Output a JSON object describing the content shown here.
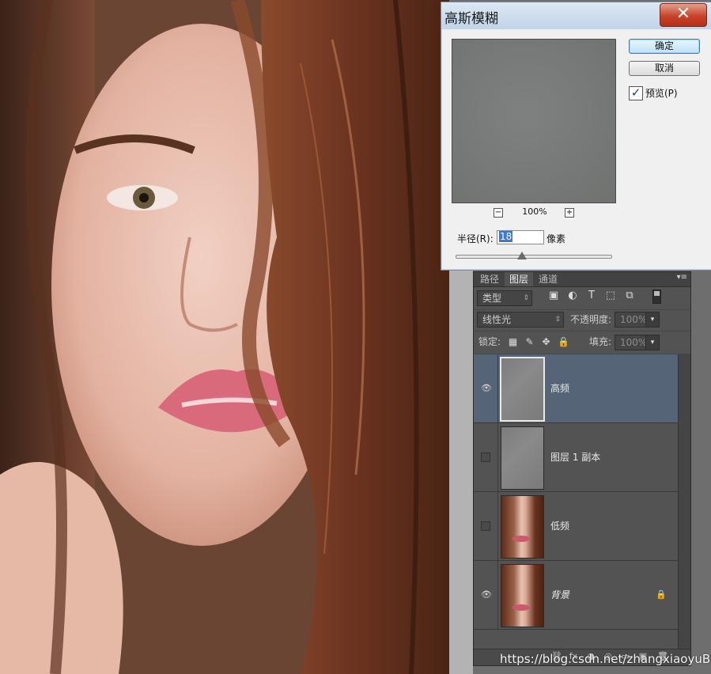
{
  "dialog": {
    "title": "高斯模糊",
    "close_glyph": "✕",
    "ok_label": "确定",
    "cancel_label": "取消",
    "preview_checked": true,
    "preview_check_glyph": "✓",
    "preview_label": "预览(P)",
    "zoom_out_glyph": "−",
    "zoom_in_glyph": "+",
    "zoom_level": "100%",
    "radius_label": "半径(R):",
    "radius_value": "18",
    "unit_label": "像素"
  },
  "layers_panel": {
    "tabs": [
      {
        "label": "路径",
        "active": false
      },
      {
        "label": "图层",
        "active": true
      },
      {
        "label": "通道",
        "active": false
      }
    ],
    "menu_glyph": "▾≡",
    "filter_kind": "类型",
    "filter_icons": [
      "image-filter-icon",
      "adjustment-filter-icon",
      "type-filter-icon",
      "shape-filter-icon",
      "smart-object-filter-icon"
    ],
    "filter_glyphs": [
      "▣",
      "◐",
      "T",
      "⬚",
      "⧉"
    ],
    "blend_mode": "线性光",
    "opacity_label": "不透明度:",
    "opacity_value": "100%",
    "lock_label": "锁定:",
    "lock_glyphs": [
      "▦",
      "✎",
      "✥",
      "🔒"
    ],
    "fill_label": "填充:",
    "fill_value": "100%",
    "dropdown_glyph": "▾",
    "layers": [
      {
        "name": "高频",
        "visible": true,
        "selected": true,
        "thumb": "gray",
        "locked": false
      },
      {
        "name": "图层 1 副本",
        "visible": false,
        "selected": false,
        "thumb": "gray",
        "locked": false
      },
      {
        "name": "低频",
        "visible": false,
        "selected": false,
        "thumb": "photo",
        "locked": false
      },
      {
        "name": "背景",
        "visible": true,
        "selected": false,
        "thumb": "photo",
        "locked": true
      }
    ],
    "eye_glyph": "👁",
    "layer_lock_glyph": "🔒",
    "footer_glyphs": [
      "⛓",
      "fx",
      "◑",
      "◎",
      "▭",
      "▣",
      "🗑"
    ]
  },
  "watermark": "https://blog.csdn.net/zhangxiaoyuBK",
  "colors": {
    "selected_layer": "#566477",
    "panel_bg": "#535353",
    "dialog_bg": "#f0f0f0",
    "close_button": "#c9432b"
  }
}
